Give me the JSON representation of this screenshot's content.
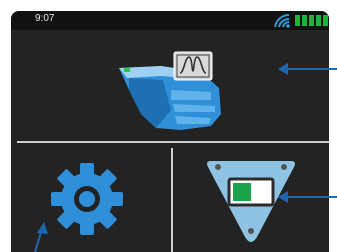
{
  "status_bar": {
    "time": "9:07",
    "wifi_icon": "wifi-icon",
    "battery_icon": "battery-full-icon",
    "battery_bars": 5
  },
  "tiles": {
    "scanner": {
      "icon": "intraoral-scanner-icon",
      "badge_icon": "waveform-icon"
    },
    "settings": {
      "icon": "gear-icon"
    },
    "device_status": {
      "icon": "toggle-shield-icon",
      "indicator_color": "#1aa34a"
    }
  },
  "colors": {
    "screen_bg": "#232323",
    "status_bar_bg": "#111111",
    "accent_blue": "#2f8fd8",
    "wifi_blue": "#2f9bd6",
    "battery_green": "#1db33a",
    "callout_arrow": "#1f66b1"
  }
}
